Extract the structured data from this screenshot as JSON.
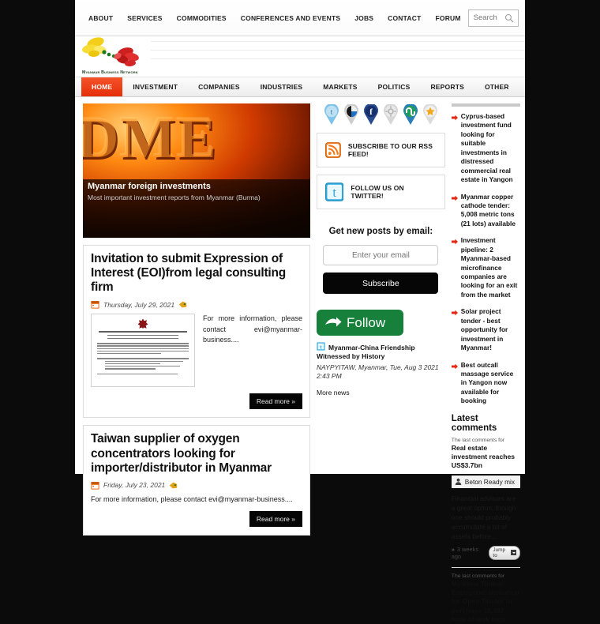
{
  "topnav": {
    "items": [
      "About",
      "Services",
      "Commodities",
      "Conferences and Events",
      "Jobs",
      "Contact",
      "Forum"
    ],
    "search_placeholder": "Search",
    "search_value": ""
  },
  "logo": {
    "text": "Myanmar Business Network"
  },
  "mainnav": {
    "items": [
      "Home",
      "Investment",
      "Companies",
      "Industries",
      "Markets",
      "Politics",
      "Reports",
      "Other"
    ],
    "active": "Home"
  },
  "hero": {
    "overlay_text": "DME",
    "title": "Myanmar foreign investments",
    "subtitle": "Most important investment reports from Myanmar (Burma)"
  },
  "articles": [
    {
      "title": "Invitation to submit Expression of Interest (EOI)from legal consulting firm",
      "date": "Thursday, July 29, 2021",
      "excerpt": "For more information, please contact evi@myanmar-business....",
      "read_more": "Read more »",
      "thumb": {
        "line1": "THE GOVERNMENT OF THE REPUBLIC OF THE UNION OF MYANMAR",
        "line2": "Kyauk Phyu Special Economic Zone Management Committee",
        "line3": "Invitation to submit Expression of Interest (EOI) from legal consulting firm"
      }
    },
    {
      "title": "Taiwan supplier of oxygen concentrators looking for importer/distributor in Myanmar",
      "date": "Friday, July 23, 2021",
      "excerpt": "For more information, please contact evi@myanmar-business....",
      "read_more": "Read more »"
    }
  ],
  "social": {
    "icons": [
      "twitter-icon",
      "delicious-icon",
      "facebook-icon",
      "digg-icon",
      "stumbleupon-icon",
      "favorites-star-icon"
    ]
  },
  "promos": [
    {
      "icon": "rss-icon",
      "label": "SUBSCRIBE TO OUR RSS FEED!"
    },
    {
      "icon": "twitter-icon",
      "label": "FOLLOW US ON TWITTER!"
    }
  ],
  "subscribe": {
    "heading": "Get new posts by email:",
    "input_placeholder": "Enter your email",
    "input_value": "",
    "button_label": "Subscribe"
  },
  "follow": {
    "label": "Follow"
  },
  "tweet": {
    "headline": "Myanmar-China Friendship Witnessed by History",
    "meta": "NAYPYITAW, Myanmar, Tue, Aug 3 2021 2:43 PM",
    "more_news": "More news"
  },
  "sidebar": {
    "news": [
      "Cyprus-based investment fund looking for suitable investments in distressed commercial real estate in Yangon",
      "Myanmar copper cathode tender: 5,008 metric tons (21 lots) available",
      "Investment pipeline: 2 Myanmar-based microfinance companies are looking for an exit from the market",
      "Solar project tender - best opportunity for investment in Myanmar!",
      "Best outcall massage service in Yangon now available for booking"
    ],
    "latest_comments": {
      "heading": "Latest comments",
      "items": [
        {
          "for_label": "The last comments for",
          "post": "Real estate investment reaches US$3.7bn",
          "author": "Beton Ready mix",
          "body": "Financial advisors are a great option, though one should probably accumulate a bit of assets before...",
          "ago": "3 weeks ago",
          "jump_label": "Jump to"
        },
        {
          "for_label": "The last comments for",
          "post": "Myanma Timber Enterprise: Invitation for Open Tender to purchase 15,387 tons of teak logs"
        }
      ]
    }
  },
  "colors": {
    "accent_red": "#e5300a",
    "follow_green": "#17803a",
    "rss_orange": "#f07a1b",
    "twitter_blue": "#2ba9e0",
    "page_bg": "#0b0b0b"
  }
}
